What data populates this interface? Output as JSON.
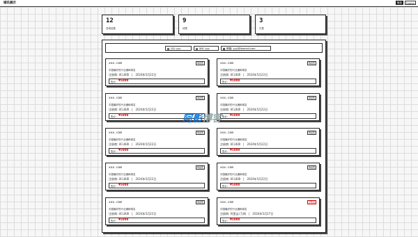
{
  "header": {
    "site_title": "域名展示",
    "theme_button": "暗色",
    "lang_button": "English"
  },
  "stats": [
    {
      "value": "12",
      "label": "总域名数"
    },
    {
      "value": "9",
      "label": "待售"
    },
    {
      "value": "3",
      "label": "已售"
    }
  ],
  "contacts": [
    {
      "icon": "qq-icon",
      "text": "QQ: yyy"
    },
    {
      "icon": "wechat-icon",
      "text": "WX: yyy"
    },
    {
      "icon": "email-icon",
      "text": "邮箱: yyy@foxmail.com"
    }
  ],
  "cards": [
    {
      "domain": "xxx.com",
      "button": "待出售",
      "desc": "中国最好的兴业通和域名",
      "registrar_label": "注册商:",
      "registrar": "UCLOUD",
      "date": "2024年5月22日",
      "price_label": "售价:",
      "price": "¥5000",
      "sold": false
    },
    {
      "domain": "xxx.com",
      "button": "待出售",
      "desc": "中国最好的兴业通和域名",
      "registrar_label": "注册商:",
      "registrar": "UCLOUD",
      "date": "2024年5月22日",
      "price_label": "售价:",
      "price": "¥5000",
      "sold": false
    },
    {
      "domain": "xxx.com",
      "button": "待出售",
      "desc": "中国最好的兴业通和域名",
      "registrar_label": "注册商:",
      "registrar": "UCLOUD",
      "date": "2024年5月22日",
      "price_label": "售价:",
      "price": "¥5000",
      "sold": false
    },
    {
      "domain": "xxx.com",
      "button": "待出售",
      "desc": "中国最好的兴业通和域名",
      "registrar_label": "注册商:",
      "registrar": "UCLOUD",
      "date": "2024年5月22日",
      "price_label": "售价:",
      "price": "¥5000",
      "sold": false
    },
    {
      "domain": "xxx.com",
      "button": "待出售",
      "desc": "中国最好的兴业通和域名",
      "registrar_label": "注册商:",
      "registrar": "UCLOUD",
      "date": "2024年5月22日",
      "price_label": "售价:",
      "price": "¥5000",
      "sold": false
    },
    {
      "domain": "xxx.com",
      "button": "待出售",
      "desc": "中国最好的兴业通和域名",
      "registrar_label": "注册商:",
      "registrar": "UCLOUD",
      "date": "2024年5月22日",
      "price_label": "售价:",
      "price": "¥5000",
      "sold": false
    },
    {
      "domain": "xxx.com",
      "button": "待出售",
      "desc": "中国最好的兴业通和域名",
      "registrar_label": "注册商:",
      "registrar": "UCLOUD",
      "date": "2024年5月22日",
      "price_label": "售价:",
      "price": "¥5000",
      "sold": false
    },
    {
      "domain": "xxx.com",
      "button": "待出售",
      "desc": "中国最好的兴业通和域名",
      "registrar_label": "注册商:",
      "registrar": "UCLOUD",
      "date": "2024年5月22日",
      "price_label": "售价:",
      "price": "¥5000",
      "sold": false
    },
    {
      "domain": "xxx.com",
      "button": "待出售",
      "desc": "中国最好的兴业通和域名",
      "registrar_label": "注册商:",
      "registrar": "UCLOUD",
      "date": "2024年5月22日",
      "price_label": "售价:",
      "price": "¥5000",
      "sold": false
    },
    {
      "domain": "xxx.com",
      "button": "已售出",
      "desc": "中国最好的兴业通和域名",
      "registrar_label": "注册商:",
      "registrar": "阿里云/万网",
      "date": "2024年5月27日",
      "price_label": "售价:",
      "price": "¥5000",
      "sold": true
    }
  ],
  "watermark": {
    "primary": "阿影",
    "secondary": "博客"
  },
  "colors": {
    "price": "#cc0000",
    "sold": "#cc0000",
    "watermark": "#1a7ad8"
  }
}
